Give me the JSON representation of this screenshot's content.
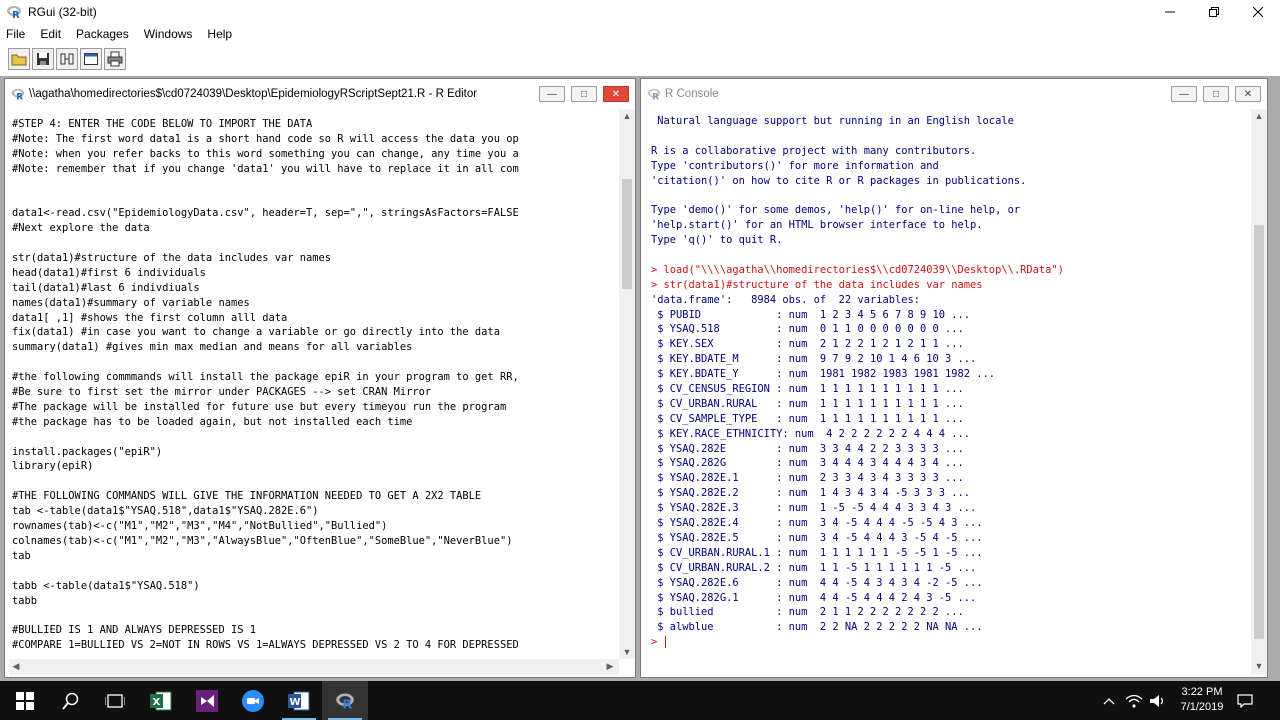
{
  "app": {
    "title": "RGui (32-bit)",
    "menus": [
      "File",
      "Edit",
      "Packages",
      "Windows",
      "Help"
    ]
  },
  "toolbar": {
    "buttons": [
      "open-script-icon",
      "save-icon",
      "copy-paste-icon",
      "console-icon",
      "print-icon"
    ]
  },
  "editor": {
    "title": "\\\\agatha\\homedirectories$\\cd0724039\\Desktop\\EpidemiologyRScriptSept21.R - R Editor",
    "lines": [
      "#STEP 4: ENTER THE CODE BELOW TO IMPORT THE DATA",
      "#Note: The first word data1 is a short hand code so R will access the data you op",
      "#Note: when you refer backs to this word something you can change, any time you a",
      "#Note: remember that if you change 'data1' you will have to replace it in all com",
      "",
      "",
      "data1<-read.csv(\"EpidemiologyData.csv\", header=T, sep=\",\", stringsAsFactors=FALSE",
      "#Next explore the data",
      "",
      "str(data1)#structure of the data includes var names",
      "head(data1)#first 6 individuals",
      "tail(data1)#last 6 indivdiuals",
      "names(data1)#summary of variable names",
      "data1[ ,1] #shows the first column alll data",
      "fix(data1) #in case you want to change a variable or go directly into the data",
      "summary(data1) #gives min max median and means for all variables",
      "",
      "#the following commmands will install the package epiR in your program to get RR,",
      "#Be sure to first set the mirror under PACKAGES --> set CRAN Mirror",
      "#The package will be installed for future use but every timeyou run the program",
      "#the package has to be loaded again, but not installed each time",
      "",
      "install.packages(\"epiR\")",
      "library(epiR)",
      "",
      "#THE FOLLOWING COMMANDS WILL GIVE THE INFORMATION NEEDED TO GET A 2X2 TABLE",
      "tab <-table(data1$\"YSAQ.518\",data1$\"YSAQ.282E.6\")",
      "rownames(tab)<-c(\"M1\",\"M2\",\"M3\",\"M4\",\"NotBullied\",\"Bullied\")",
      "colnames(tab)<-c(\"M1\",\"M2\",\"M3\",\"AlwaysBlue\",\"OftenBlue\",\"SomeBlue\",\"NeverBlue\")",
      "tab",
      "",
      "tabb <-table(data1$\"YSAQ.518\")",
      "tabb",
      "",
      "#BULLIED IS 1 AND ALWAYS DEPRESSED IS 1",
      "#COMPARE 1=BULLIED VS 2=NOT IN ROWS VS 1=ALWAYS DEPRESSED VS 2 TO 4 FOR DEPRESSED"
    ]
  },
  "console": {
    "title": "R Console",
    "lines": [
      {
        "t": " Natural language support but running in an English locale",
        "k": "out"
      },
      {
        "t": "",
        "k": "out"
      },
      {
        "t": "R is a collaborative project with many contributors.",
        "k": "out"
      },
      {
        "t": "Type 'contributors()' for more information and",
        "k": "out"
      },
      {
        "t": "'citation()' on how to cite R or R packages in publications.",
        "k": "out"
      },
      {
        "t": "",
        "k": "out"
      },
      {
        "t": "Type 'demo()' for some demos, 'help()' for on-line help, or",
        "k": "out"
      },
      {
        "t": "'help.start()' for an HTML browser interface to help.",
        "k": "out"
      },
      {
        "t": "Type 'q()' to quit R.",
        "k": "out"
      },
      {
        "t": "",
        "k": "out"
      },
      {
        "t": "> load(\"\\\\\\\\agatha\\\\homedirectories$\\\\cd0724039\\\\Desktop\\\\.RData\")",
        "k": "in"
      },
      {
        "t": "> str(data1)#structure of the data includes var names",
        "k": "in"
      },
      {
        "t": "'data.frame':   8984 obs. of  22 variables:",
        "k": "out"
      },
      {
        "t": " $ PUBID            : num  1 2 3 4 5 6 7 8 9 10 ...",
        "k": "out"
      },
      {
        "t": " $ YSAQ.518         : num  0 1 1 0 0 0 0 0 0 0 ...",
        "k": "out"
      },
      {
        "t": " $ KEY.SEX          : num  2 1 2 2 1 2 1 2 1 1 ...",
        "k": "out"
      },
      {
        "t": " $ KEY.BDATE_M      : num  9 7 9 2 10 1 4 6 10 3 ...",
        "k": "out"
      },
      {
        "t": " $ KEY.BDATE_Y      : num  1981 1982 1983 1981 1982 ...",
        "k": "out"
      },
      {
        "t": " $ CV_CENSUS_REGION : num  1 1 1 1 1 1 1 1 1 1 ...",
        "k": "out"
      },
      {
        "t": " $ CV_URBAN.RURAL   : num  1 1 1 1 1 1 1 1 1 1 ...",
        "k": "out"
      },
      {
        "t": " $ CV_SAMPLE_TYPE   : num  1 1 1 1 1 1 1 1 1 1 ...",
        "k": "out"
      },
      {
        "t": " $ KEY.RACE_ETHNICITY: num  4 2 2 2 2 2 2 4 4 4 ...",
        "k": "out"
      },
      {
        "t": " $ YSAQ.282E        : num  3 3 4 4 2 2 3 3 3 3 ...",
        "k": "out"
      },
      {
        "t": " $ YSAQ.282G        : num  3 4 4 4 3 4 4 4 3 4 ...",
        "k": "out"
      },
      {
        "t": " $ YSAQ.282E.1      : num  2 3 3 4 3 4 3 3 3 3 ...",
        "k": "out"
      },
      {
        "t": " $ YSAQ.282E.2      : num  1 4 3 4 3 4 -5 3 3 3 ...",
        "k": "out"
      },
      {
        "t": " $ YSAQ.282E.3      : num  1 -5 -5 4 4 4 3 3 4 3 ...",
        "k": "out"
      },
      {
        "t": " $ YSAQ.282E.4      : num  3 4 -5 4 4 4 -5 -5 4 3 ...",
        "k": "out"
      },
      {
        "t": " $ YSAQ.282E.5      : num  3 4 -5 4 4 4 3 -5 4 -5 ...",
        "k": "out"
      },
      {
        "t": " $ CV_URBAN.RURAL.1 : num  1 1 1 1 1 1 -5 -5 1 -5 ...",
        "k": "out"
      },
      {
        "t": " $ CV_URBAN.RURAL.2 : num  1 1 -5 1 1 1 1 1 1 -5 ...",
        "k": "out"
      },
      {
        "t": " $ YSAQ.282E.6      : num  4 4 -5 4 3 4 3 4 -2 -5 ...",
        "k": "out"
      },
      {
        "t": " $ YSAQ.282G.1      : num  4 4 -5 4 4 4 2 4 3 -5 ...",
        "k": "out"
      },
      {
        "t": " $ bullied          : num  2 1 1 2 2 2 2 2 2 2 ...",
        "k": "out"
      },
      {
        "t": " $ alwblue          : num  2 2 NA 2 2 2 2 2 NA NA ...",
        "k": "out"
      },
      {
        "t": "> ",
        "k": "in"
      }
    ]
  },
  "taskbar": {
    "apps": [
      "windows-start-icon",
      "search-icon",
      "task-view-icon",
      "excel-icon",
      "visual-studio-icon",
      "zoom-icon",
      "word-icon",
      "r-gui-icon"
    ],
    "time": "3:22 PM",
    "date": "7/1/2019"
  },
  "colors": {
    "console_input": "#c81515",
    "console_output": "#000080",
    "close_button": "#e4463c",
    "taskbar": "#101010"
  }
}
